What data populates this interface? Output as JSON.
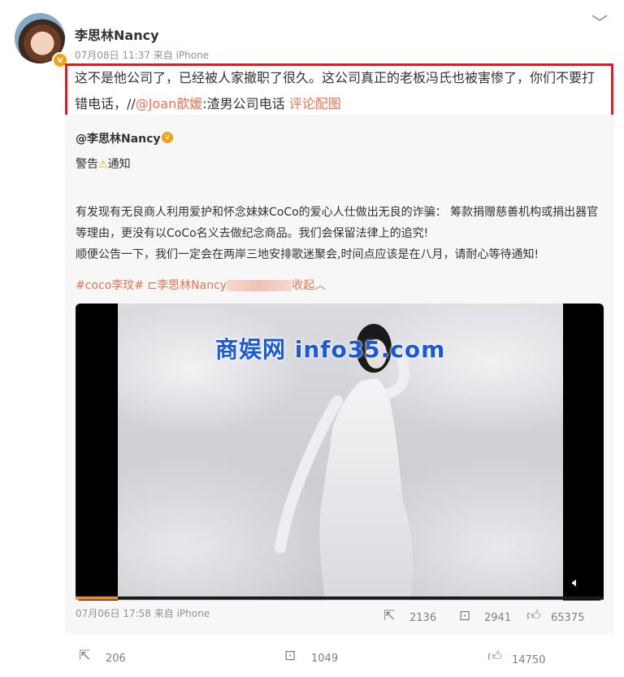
{
  "post": {
    "author": "李思林Nancy",
    "meta": "07月08日 11:37  来自 iPhone",
    "text_part1": "这不是他公司了，已经被人家撤职了很久。这公司真正的老板冯氏也被害惨了，你们不要打错电话，//",
    "mention": "@Joan歆媛",
    "text_part2": ":渣男公司电话 ",
    "image_link": "评论配图"
  },
  "repost": {
    "author": "@李思林Nancy",
    "warning_pre": "警告",
    "warning_post": "通知",
    "line1": "有发现有无良商人利用爱护和怀念妹妹CoCo的爱心人仕做出无良的诈骗： 筹款捐赠慈善机构或捐出器官等理由，更没有以CoCo名义去做纪念商品。我们会保留法律上的追究!",
    "line2": "顺便公告一下，我们一定会在两岸三地安排歌迷聚会,时间点应该是在八月，请耐心等待通知!",
    "tag1": "#coco李玟#",
    "tag2": "李思林Nancy",
    "collapse": "收起",
    "meta": "07月06日 17:58  来自 iPhone",
    "shares": "2136",
    "comments": "2941",
    "likes": "65375"
  },
  "video": {
    "watermark": "商娱网 info35.com",
    "progress": 0.08
  },
  "footer": {
    "shares": "206",
    "comments": "1049",
    "likes": "14750"
  },
  "icons": {
    "share": "share-icon",
    "comment": "comment-icon",
    "like": "like-icon",
    "volume": "volume-icon",
    "chevron": "chevron-down-icon"
  },
  "colors": {
    "link": "#eb7350",
    "highlight": "#e5191f",
    "verified": "#f3a218"
  }
}
